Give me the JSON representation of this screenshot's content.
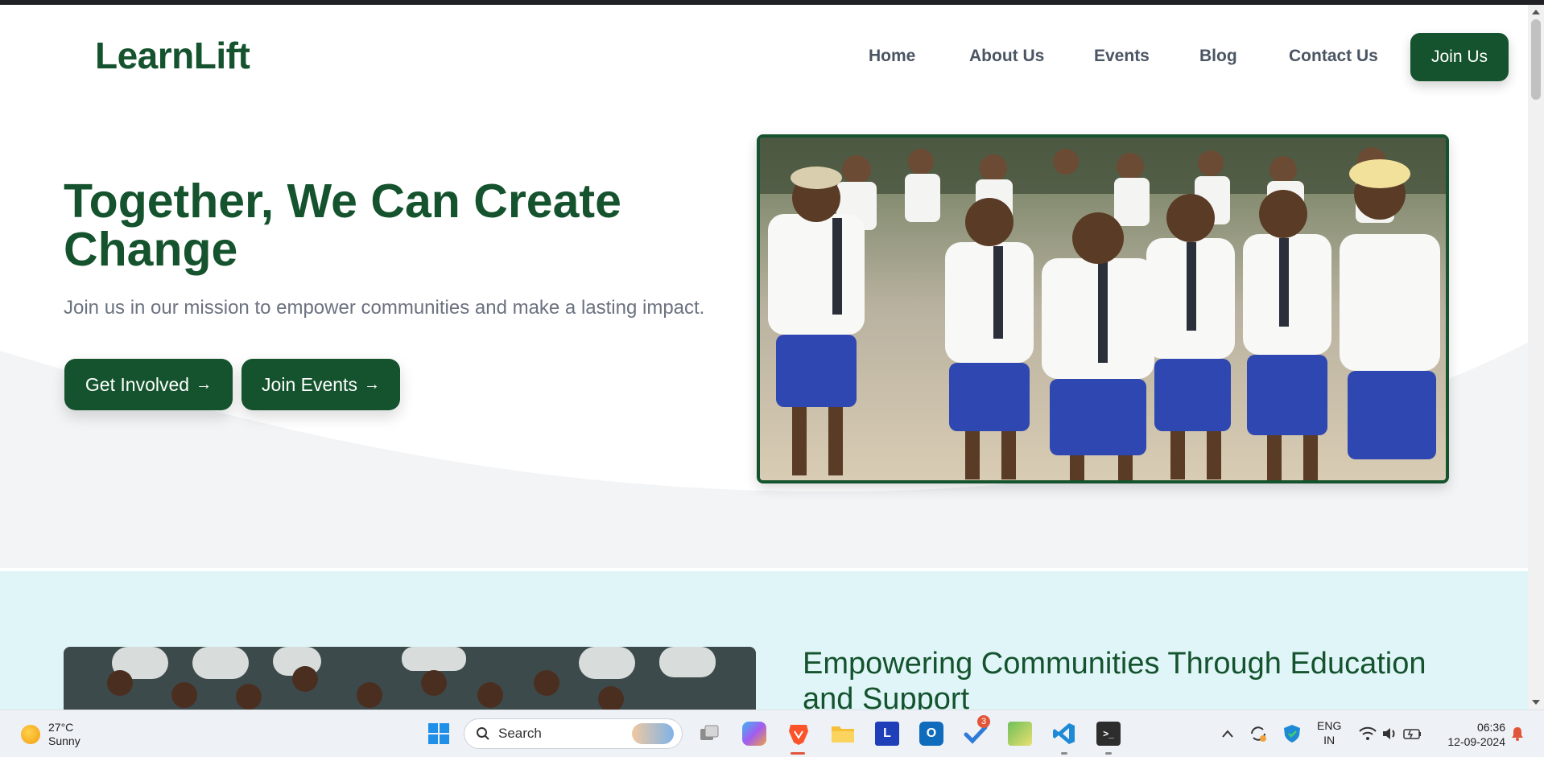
{
  "header": {
    "logo": "LearnLift",
    "nav": [
      "Home",
      "About Us",
      "Events",
      "Blog",
      "Contact Us"
    ],
    "join_button": "Join Us"
  },
  "hero": {
    "title": "Together, We Can Create Change",
    "subtitle": "Join us in our mission to empower communities and make a lasting impact.",
    "primary_button": "Get Involved",
    "secondary_button": "Join Events",
    "arrow": "→"
  },
  "section2": {
    "title": "Empowering Communities Through Education and Support"
  },
  "taskbar": {
    "weather_temp": "27°C",
    "weather_desc": "Sunny",
    "search_placeholder": "Search",
    "todo_badge": "3",
    "lang_line1": "ENG",
    "lang_line2": "IN",
    "time": "06:36",
    "date": "12-09-2024"
  },
  "colors": {
    "brand_green": "#14532d",
    "section2_bg": "#e0f5f8",
    "muted_text": "#6b7280"
  },
  "icons": [
    "windows-start-icon",
    "search-icon",
    "task-view-icon",
    "copilot-icon",
    "brave-browser-icon",
    "file-explorer-icon",
    "l-app-icon",
    "outlook-icon",
    "todo-icon",
    "notepad-icon",
    "vscode-icon",
    "terminal-icon",
    "chevron-up-icon",
    "sync-icon",
    "defender-icon",
    "wifi-icon",
    "volume-icon",
    "battery-icon",
    "notification-icon"
  ]
}
